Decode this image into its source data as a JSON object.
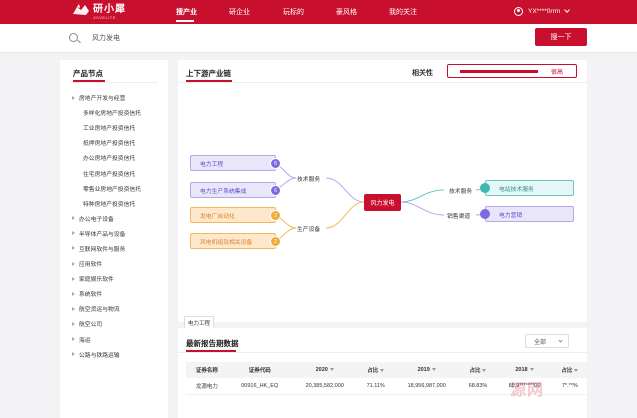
{
  "brand": {
    "name": "研小犀",
    "sub": "JOVELITE"
  },
  "nav": {
    "items": [
      "搜产业",
      "研企业",
      "玩标的",
      "豪风格",
      "我的关注"
    ],
    "active_index": 0
  },
  "user": {
    "name": "YX****0rrm"
  },
  "search": {
    "value": "风力发电",
    "button": "搜一下"
  },
  "left_panel": {
    "title": "产品节点",
    "items": [
      {
        "label": "房地产开发与经营",
        "level": 1
      },
      {
        "label": "多样化房地产投资信托",
        "level": 2
      },
      {
        "label": "工业房地产投资信托",
        "level": 2
      },
      {
        "label": "抵押房地产投资信托",
        "level": 2
      },
      {
        "label": "办公房地产投资信托",
        "level": 2
      },
      {
        "label": "住宅房地产投资信托",
        "level": 2
      },
      {
        "label": "零售业房地产投资信托",
        "level": 2
      },
      {
        "label": "特种房地产投资信托",
        "level": 2
      },
      {
        "label": "办公电子设备",
        "level": 1
      },
      {
        "label": "半导体产品与设备",
        "level": 1
      },
      {
        "label": "互联网软件与服务",
        "level": 1
      },
      {
        "label": "应用软件",
        "level": 1
      },
      {
        "label": "家庭娱乐软件",
        "level": 1
      },
      {
        "label": "系统软件",
        "level": 1
      },
      {
        "label": "航空货运与物流",
        "level": 1
      },
      {
        "label": "航空公司",
        "level": 1
      },
      {
        "label": "海运",
        "level": 1
      },
      {
        "label": "公路与铁路运输",
        "level": 1
      }
    ]
  },
  "chain": {
    "tab": "上下游产业链",
    "correlation_label": "相关性",
    "correlation_value": "很高",
    "correlation_level": 0.6,
    "center": "风力发电",
    "upstream": [
      {
        "label": "电力工程",
        "badge": "6",
        "color": "purple"
      },
      {
        "label": "电力生产系统集成",
        "badge": "6",
        "color": "purple"
      },
      {
        "label": "发电厂自动化",
        "badge": "2",
        "color": "orange"
      },
      {
        "label": "风电机组及相关设备",
        "badge": "2",
        "color": "orange"
      }
    ],
    "upstream_groups": [
      "技术服务",
      "生产设备"
    ],
    "downstream_groups": [
      "技术服务",
      "销售渠道"
    ],
    "downstream": [
      {
        "label": "电站技术服务",
        "color": "teal"
      },
      {
        "label": "电力营销",
        "color": "purple"
      }
    ],
    "colors": {
      "purple": "#b3a8ee",
      "orange": "#f7b85b",
      "teal": "#6fc7c2"
    }
  },
  "tooltip": "电力工程",
  "report": {
    "title": "最新报告期数据",
    "select_value": "全部",
    "headers": [
      "证券名称",
      "证券代码",
      "2020",
      "占比",
      "2019",
      "占比",
      "2018",
      "占比"
    ],
    "rows": [
      [
        "龙源电力",
        "00916_HK_EQ",
        "20,385,582,000",
        "71.11%",
        "18,956,987,000",
        "68.83%",
        "88,9*******00",
        "7*.**%"
      ]
    ]
  },
  "watermark": "源网"
}
